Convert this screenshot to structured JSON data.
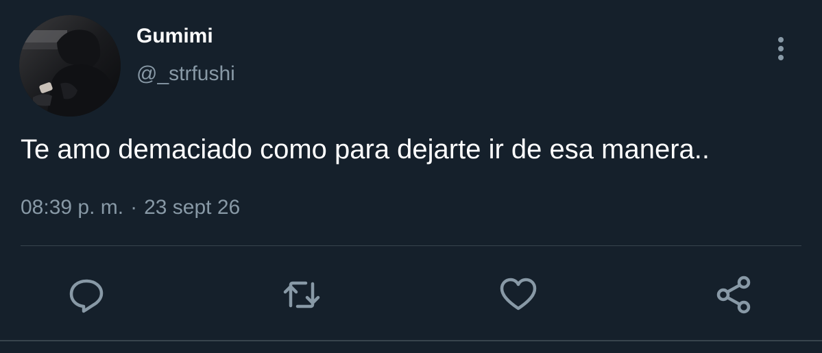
{
  "tweet": {
    "display_name": "Gumimi",
    "handle": "@_strfushi",
    "text": "Te amo demaciado como para dejarte ir de esa manera..",
    "time": "08:39 p. m.",
    "separator": "·",
    "date": "23 sept 26"
  },
  "icons": {
    "more": "more-vertical-icon",
    "reply": "reply-icon",
    "retweet": "retweet-icon",
    "like": "heart-icon",
    "share": "share-icon"
  },
  "colors": {
    "background": "#15202b",
    "primary_text": "#ffffff",
    "secondary_text": "#8899a6",
    "icon": "#8899a6",
    "divider": "#38444d"
  }
}
